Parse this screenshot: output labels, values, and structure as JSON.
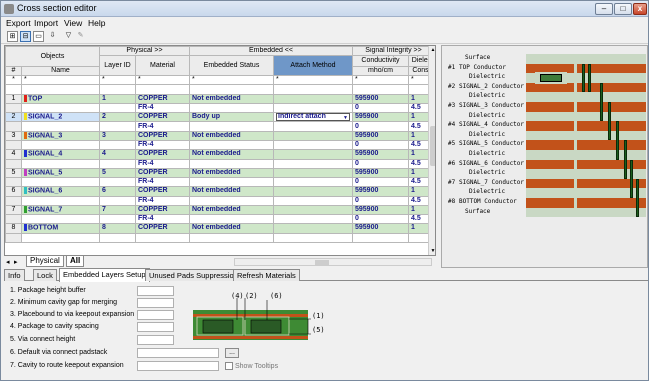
{
  "window": {
    "title": "Cross section editor",
    "minimize": "–",
    "maximize": "□",
    "close": "x"
  },
  "menu": [
    "Export",
    "Import",
    "View",
    "Help"
  ],
  "toolbar": {
    "btn1": "⊞",
    "btn2": "⊟",
    "btn3": "▭",
    "btn4": "⇩",
    "btn5": "▽",
    "btn6": "✎"
  },
  "grid": {
    "group_headers": {
      "objects": "Objects",
      "physical": "Physical >>",
      "embedded": "Embedded <<",
      "signal": "Signal Integrity >>"
    },
    "columns": {
      "num": "#",
      "name": "Name",
      "layer_id": "Layer ID",
      "material": "Material",
      "embedded_status": "Embedded Status",
      "attach_method": "Attach Method",
      "conductivity": "Conductivity",
      "conductivity_unit": "mho/cm",
      "dielec": "Dielec",
      "dielec2": "Const"
    },
    "filter": "*",
    "rows": [
      {
        "num": "1",
        "name": "TOP",
        "color": "#e0201a",
        "layer_id": "1",
        "material": "COPPER",
        "dielectric": "FR-4",
        "status": "Not embedded",
        "attach": "",
        "cond": "595900",
        "dk": "1",
        "cond2": "0",
        "dk2": "4.5"
      },
      {
        "num": "2",
        "name": "SIGNAL_2",
        "color": "#f0e020",
        "layer_id": "2",
        "material": "COPPER",
        "dielectric": "FR-4",
        "status": "Body up",
        "attach": "Indirect attach",
        "cond": "595900",
        "dk": "1",
        "cond2": "0",
        "dk2": "4.5"
      },
      {
        "num": "3",
        "name": "SIGNAL_3",
        "color": "#e06a10",
        "layer_id": "3",
        "material": "COPPER",
        "dielectric": "FR-4",
        "status": "Not embedded",
        "attach": "",
        "cond": "595900",
        "dk": "1",
        "cond2": "0",
        "dk2": "4.5"
      },
      {
        "num": "4",
        "name": "SIGNAL_4",
        "color": "#2030d0",
        "layer_id": "4",
        "material": "COPPER",
        "dielectric": "FR-4",
        "status": "Not embedded",
        "attach": "",
        "cond": "595900",
        "dk": "1",
        "cond2": "0",
        "dk2": "4.5"
      },
      {
        "num": "5",
        "name": "SIGNAL_5",
        "color": "#c040c0",
        "layer_id": "5",
        "material": "COPPER",
        "dielectric": "FR-4",
        "status": "Not embedded",
        "attach": "",
        "cond": "595900",
        "dk": "1",
        "cond2": "0",
        "dk2": "4.5"
      },
      {
        "num": "6",
        "name": "SIGNAL_6",
        "color": "#30c0c0",
        "layer_id": "6",
        "material": "COPPER",
        "dielectric": "FR-4",
        "status": "Not embedded",
        "attach": "",
        "cond": "595900",
        "dk": "1",
        "cond2": "0",
        "dk2": "4.5"
      },
      {
        "num": "7",
        "name": "SIGNAL_7",
        "color": "#30a030",
        "layer_id": "7",
        "material": "COPPER",
        "dielectric": "FR-4",
        "status": "Not embedded",
        "attach": "",
        "cond": "595900",
        "dk": "1",
        "cond2": "0",
        "dk2": "4.5"
      },
      {
        "num": "8",
        "name": "BOTTOM",
        "color": "#2030d0",
        "layer_id": "8",
        "material": "COPPER",
        "dielectric": "",
        "status": "Not embedded",
        "attach": "",
        "cond": "595900",
        "dk": "1",
        "cond2": "",
        "dk2": ""
      }
    ]
  },
  "grid_tabs": {
    "physical": "Physical",
    "all": "All",
    "prev": "◂",
    "next": "▸"
  },
  "stackup": {
    "surface": "Surface",
    "dielectric": "Dielectric",
    "layers": [
      {
        "num": "#1",
        "label": "TOP Conductor"
      },
      {
        "num": "#2",
        "label": "SIGNAL_2 Conductor"
      },
      {
        "num": "#3",
        "label": "SIGNAL_3 Conductor"
      },
      {
        "num": "#4",
        "label": "SIGNAL_4 Conductor"
      },
      {
        "num": "#5",
        "label": "SIGNAL_5 Conductor"
      },
      {
        "num": "#6",
        "label": "SIGNAL_6 Conductor"
      },
      {
        "num": "#7",
        "label": "SIGNAL_7 Conductor"
      },
      {
        "num": "#8",
        "label": "BOTTOM Conductor"
      }
    ],
    "colors": {
      "conductor": "#c2521a",
      "dielectric": "#c9d8c4",
      "via": "#1c5e1c"
    }
  },
  "panel_tabs": [
    "Info",
    "Lock",
    "Embedded Layers Setup",
    "Unused Pads Suppression",
    "Refresh Materials"
  ],
  "panel": {
    "params": [
      "1. Package height buffer",
      "2. Minimum cavity gap for merging",
      "3. Placebound to via keepout expansion",
      "4. Package to cavity spacing",
      "5. Via connect height",
      "6. Default via connect padstack",
      "7. Cavity to route keepout expansion"
    ],
    "browse": "...",
    "show_tooltips": "Show Tooltips",
    "diagram_labels": {
      "l4": "(4)",
      "l2": "(2)",
      "l6": "(6)",
      "l1": "(1)",
      "l5": "(5)"
    }
  }
}
